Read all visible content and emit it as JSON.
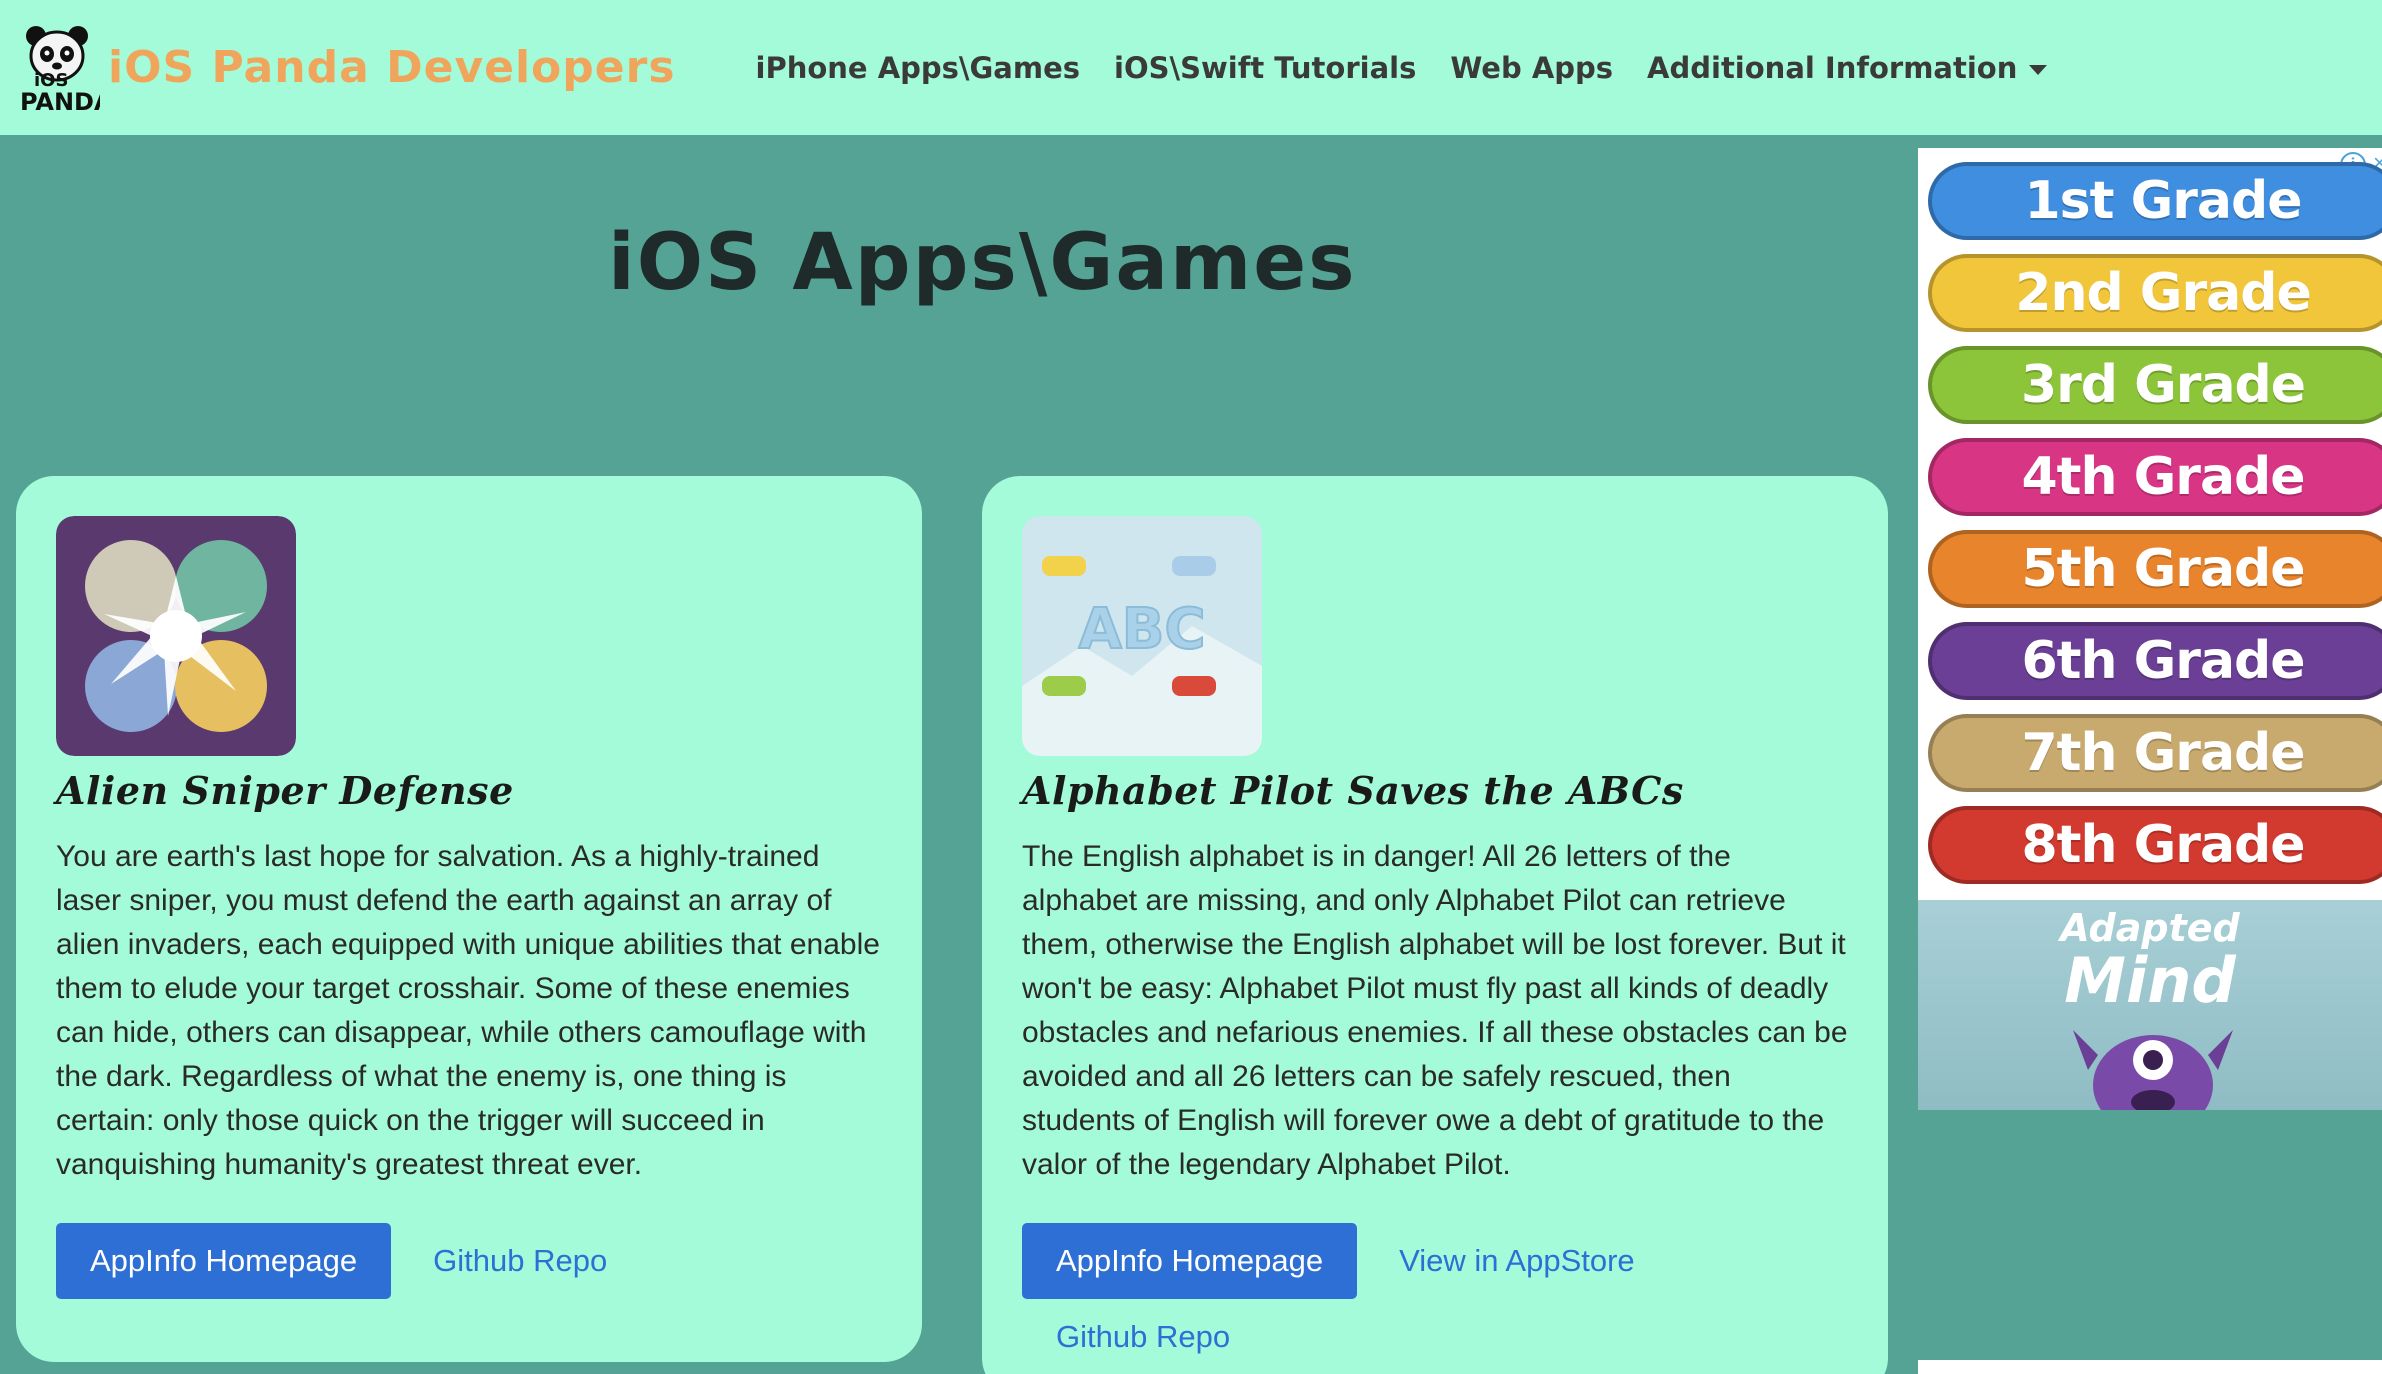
{
  "brand": {
    "name": "iOS Panda Developers",
    "logo_icon": "panda-logo-icon",
    "logo_text": "iOS PANDA"
  },
  "nav": {
    "items": [
      {
        "label": "iPhone Apps\\Games"
      },
      {
        "label": "iOS\\Swift Tutorials"
      },
      {
        "label": "Web Apps"
      },
      {
        "label": "Additional Information"
      }
    ]
  },
  "page": {
    "title": "iOS Apps\\Games"
  },
  "apps": [
    {
      "title": "Alien Sniper Defense",
      "description": "You are earth's last hope for salvation. As a highly-trained laser sniper, you must defend the earth against an array of alien invaders, each equipped with unique abilities that enable them to elude your target crosshair. Some of these enemies can hide, others can disappear, while others camouflage with the dark. Regardless of what the enemy is, one thing is certain: only those quick on the trigger will succeed in vanquishing humanity's greatest threat ever.",
      "primary_button": "AppInfo Homepage",
      "links": [
        "Github Repo"
      ],
      "icon": "alien-sniper-app-icon"
    },
    {
      "title": "Alphabet Pilot Saves the ABCs",
      "description": "The English alphabet is in danger! All 26 letters of the alphabet are missing, and only Alphabet Pilot can retrieve them, otherwise the English alphabet will be lost forever. But it won't be easy: Alphabet Pilot must fly past all kinds of deadly obstacles and nefarious enemies. If all these obstacles can be avoided and all 26 letters can be safely rescued, then students of English will forever owe a debt of gratitude to the valor of the legendary Alphabet Pilot.",
      "primary_button": "AppInfo Homepage",
      "links": [
        "View in AppStore",
        "Github Repo"
      ],
      "icon": "alphabet-pilot-app-icon",
      "icon_text": "ABC"
    }
  ],
  "ad": {
    "grades": [
      {
        "label": "1st Grade",
        "color": "#3f8ee0"
      },
      {
        "label": "2nd Grade",
        "color": "#f2c63a"
      },
      {
        "label": "3rd Grade",
        "color": "#8cc43a"
      },
      {
        "label": "4th Grade",
        "color": "#d93585"
      },
      {
        "label": "5th Grade",
        "color": "#e8842b"
      },
      {
        "label": "6th Grade",
        "color": "#6a3f95"
      },
      {
        "label": "7th Grade",
        "color": "#c8aa6e"
      },
      {
        "label": "8th Grade",
        "color": "#d23a2f"
      }
    ],
    "brand_line1": "Adapted",
    "brand_line2": "Mind",
    "info_icon": "i",
    "close_icon": "×"
  },
  "colors": {
    "navbar_bg": "#a3fbd9",
    "page_bg": "#55a395",
    "brand": "#f0a55c",
    "button": "#2e6fd6"
  }
}
